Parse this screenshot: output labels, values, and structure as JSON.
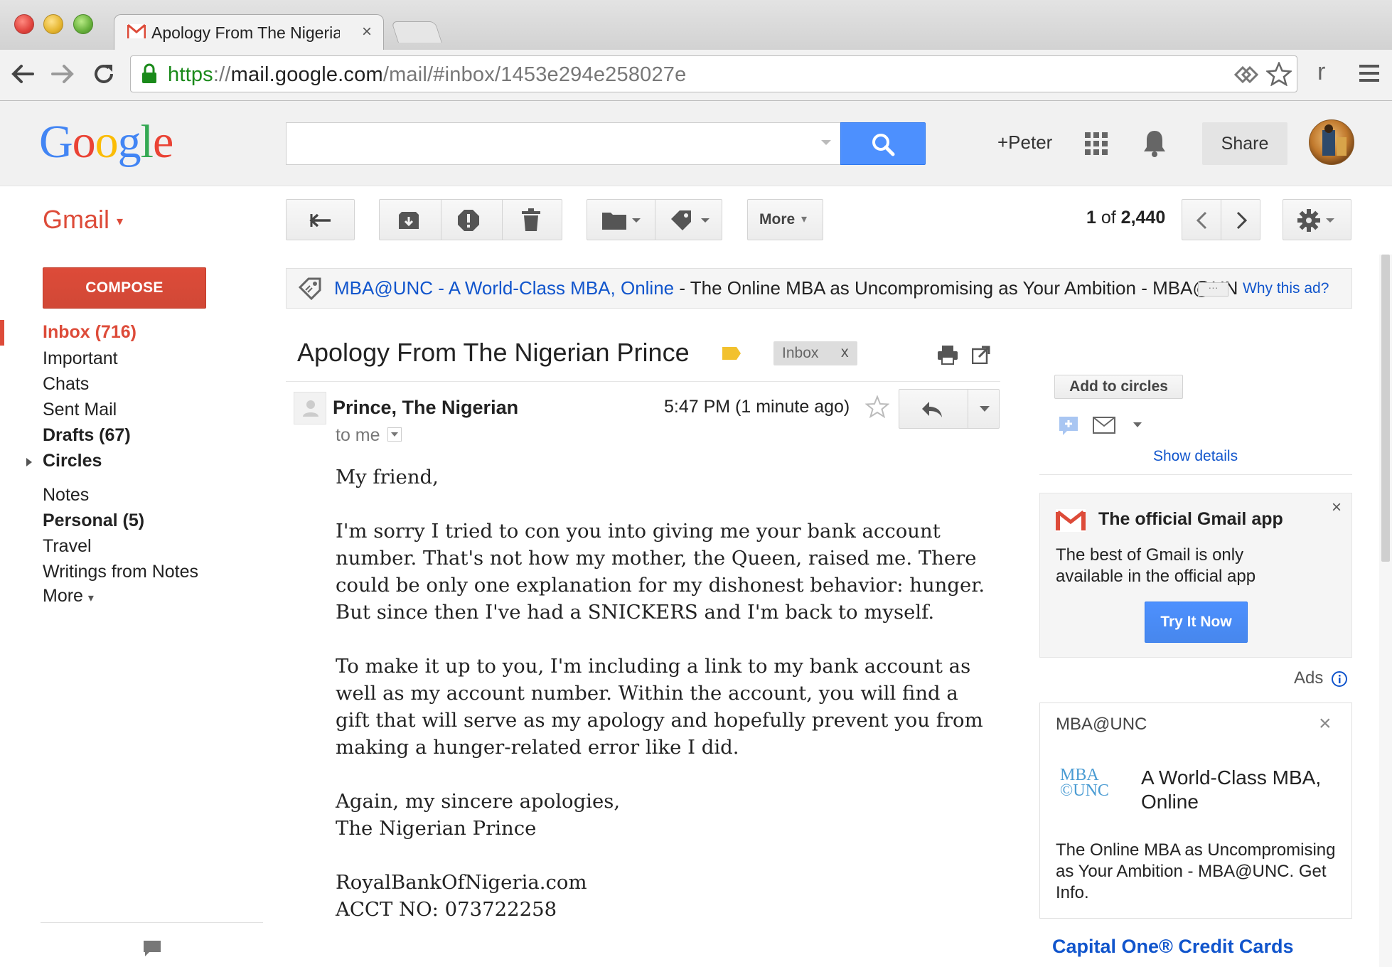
{
  "browser": {
    "tab_title": "Apology From The Nigerian Prince",
    "tab_close": "×",
    "url_https": "https",
    "url_sep": "://",
    "url_domain": "mail.google.com",
    "url_path": "/mail/#inbox/1453e294e258027e",
    "extension_letter": "r"
  },
  "header": {
    "logo": [
      "G",
      "o",
      "o",
      "g",
      "l",
      "e"
    ],
    "search_placeholder": "",
    "user_link": "+Peter",
    "share_label": "Share"
  },
  "toolbar": {
    "app_label": "Gmail",
    "more_label": "More",
    "count_current": "1",
    "count_of": "of",
    "count_total": "2,440"
  },
  "nav": {
    "compose_label": "COMPOSE",
    "items": [
      {
        "label": "Inbox (716)"
      },
      {
        "label": "Important"
      },
      {
        "label": "Chats"
      },
      {
        "label": "Sent Mail"
      },
      {
        "label": "Drafts (67)"
      },
      {
        "label": "Circles"
      },
      {
        "label": "Notes"
      },
      {
        "label": "Personal (5)"
      },
      {
        "label": "Travel"
      },
      {
        "label": "Writings from Notes"
      },
      {
        "label": "More"
      }
    ]
  },
  "ad_banner": {
    "link_text": "MBA@UNC - A World-Class MBA, Online",
    "text": " - The Online MBA as Uncompromising as Your Ambition - MBA@UNC. Get Info.",
    "ellipsis": "···",
    "why_label": "Why this ad?"
  },
  "message": {
    "subject": "Apology From The Nigerian Prince",
    "label_chip": "Inbox",
    "label_chip_remove": "x",
    "sender": "Prince, The Nigerian",
    "recipient": "to me",
    "time": "5:47 PM (1 minute ago)",
    "body": {
      "greeting": "My friend,",
      "p1": [
        "I'm sorry I tried to con you into giving me your bank account",
        "number. That's not how my mother, the Queen, raised me. There",
        "could be only one explanation for my dishonest behavior: hunger.",
        "But since then I've had a SNICKERS and I'm back to myself."
      ],
      "p2": [
        "To make it up to you, I'm including a link to my bank account as",
        "well as my account number. Within the account, you will find a",
        "gift that will serve as my apology and hopefully prevent you from",
        "making a hunger-related error like I did."
      ],
      "closing": [
        "Again, my sincere apologies,",
        "The Nigerian Prince"
      ],
      "bank_site": "RoyalBankOfNigeria.com",
      "account": "ACCT NO: 073722258"
    }
  },
  "sidebar": {
    "add_circles_label": "Add to circles",
    "show_details_label": "Show details",
    "app_promo": {
      "title": "The official Gmail app",
      "description": "The best of Gmail is only available in the official app",
      "button_label": "Try It Now",
      "close": "×"
    },
    "ads_label": "Ads",
    "ad": {
      "advertiser": "MBA@UNC",
      "close": "×",
      "logo_line1": "MBA",
      "logo_line2": "©UNC",
      "headline": "A World-Class MBA, Online",
      "description": "The Online MBA as Uncompromising as Your Ambition - MBA@UNC. Get Info."
    },
    "next_ad_title": "Capital One® Credit Cards"
  },
  "colors": {
    "gmail_red": "#dd4b39",
    "search_blue": "#4d90fe",
    "link_blue": "#1155cc",
    "url_green": "#1a8a1a"
  },
  "icons": [
    "back-arrow-icon",
    "forward-arrow-icon",
    "reload-icon",
    "lock-icon",
    "star-icon",
    "menu-icon",
    "search-icon",
    "apps-grid-icon",
    "bell-icon",
    "archive-icon",
    "spam-icon",
    "trash-icon",
    "folder-icon",
    "label-icon",
    "settings-gear-icon",
    "print-icon",
    "popout-icon",
    "reply-icon",
    "chat-icon"
  ]
}
